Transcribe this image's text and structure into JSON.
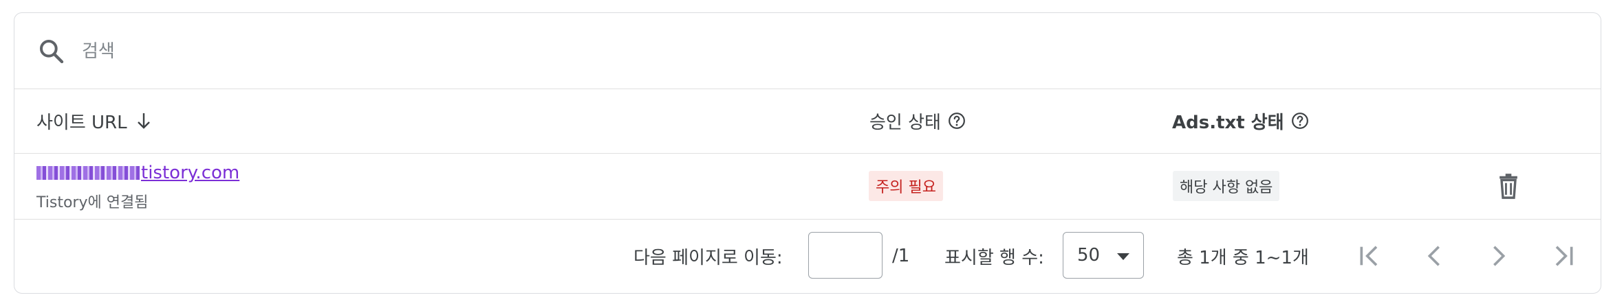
{
  "search": {
    "placeholder": "검색"
  },
  "table": {
    "headers": {
      "url_label": "사이트 URL",
      "status_label": "승인 상태",
      "ads_label": "Ads.txt 상태"
    },
    "rows": [
      {
        "site_domain": "tistory.com",
        "site_sub": "Tistory에 연결됨",
        "status": "주의 필요",
        "ads_status": "해당 사항 없음"
      }
    ]
  },
  "pagination": {
    "goto_label": "다음 페이지로 이동:",
    "goto_value": "",
    "total_pages": "/1",
    "rows_label": "표시할 행 수:",
    "rows_value": "50",
    "range": "총 1개 중 1~1개"
  },
  "colors": {
    "link": "#7b2ed6",
    "warn_bg": "#fce8e6",
    "warn_text": "#c5221f",
    "neutral_bg": "#f1f3f4",
    "border": "#dadce0"
  },
  "icons": [
    "search-icon",
    "arrow-down-icon",
    "help-icon",
    "trash-icon",
    "first-page-icon",
    "prev-page-icon",
    "next-page-icon",
    "last-page-icon"
  ]
}
